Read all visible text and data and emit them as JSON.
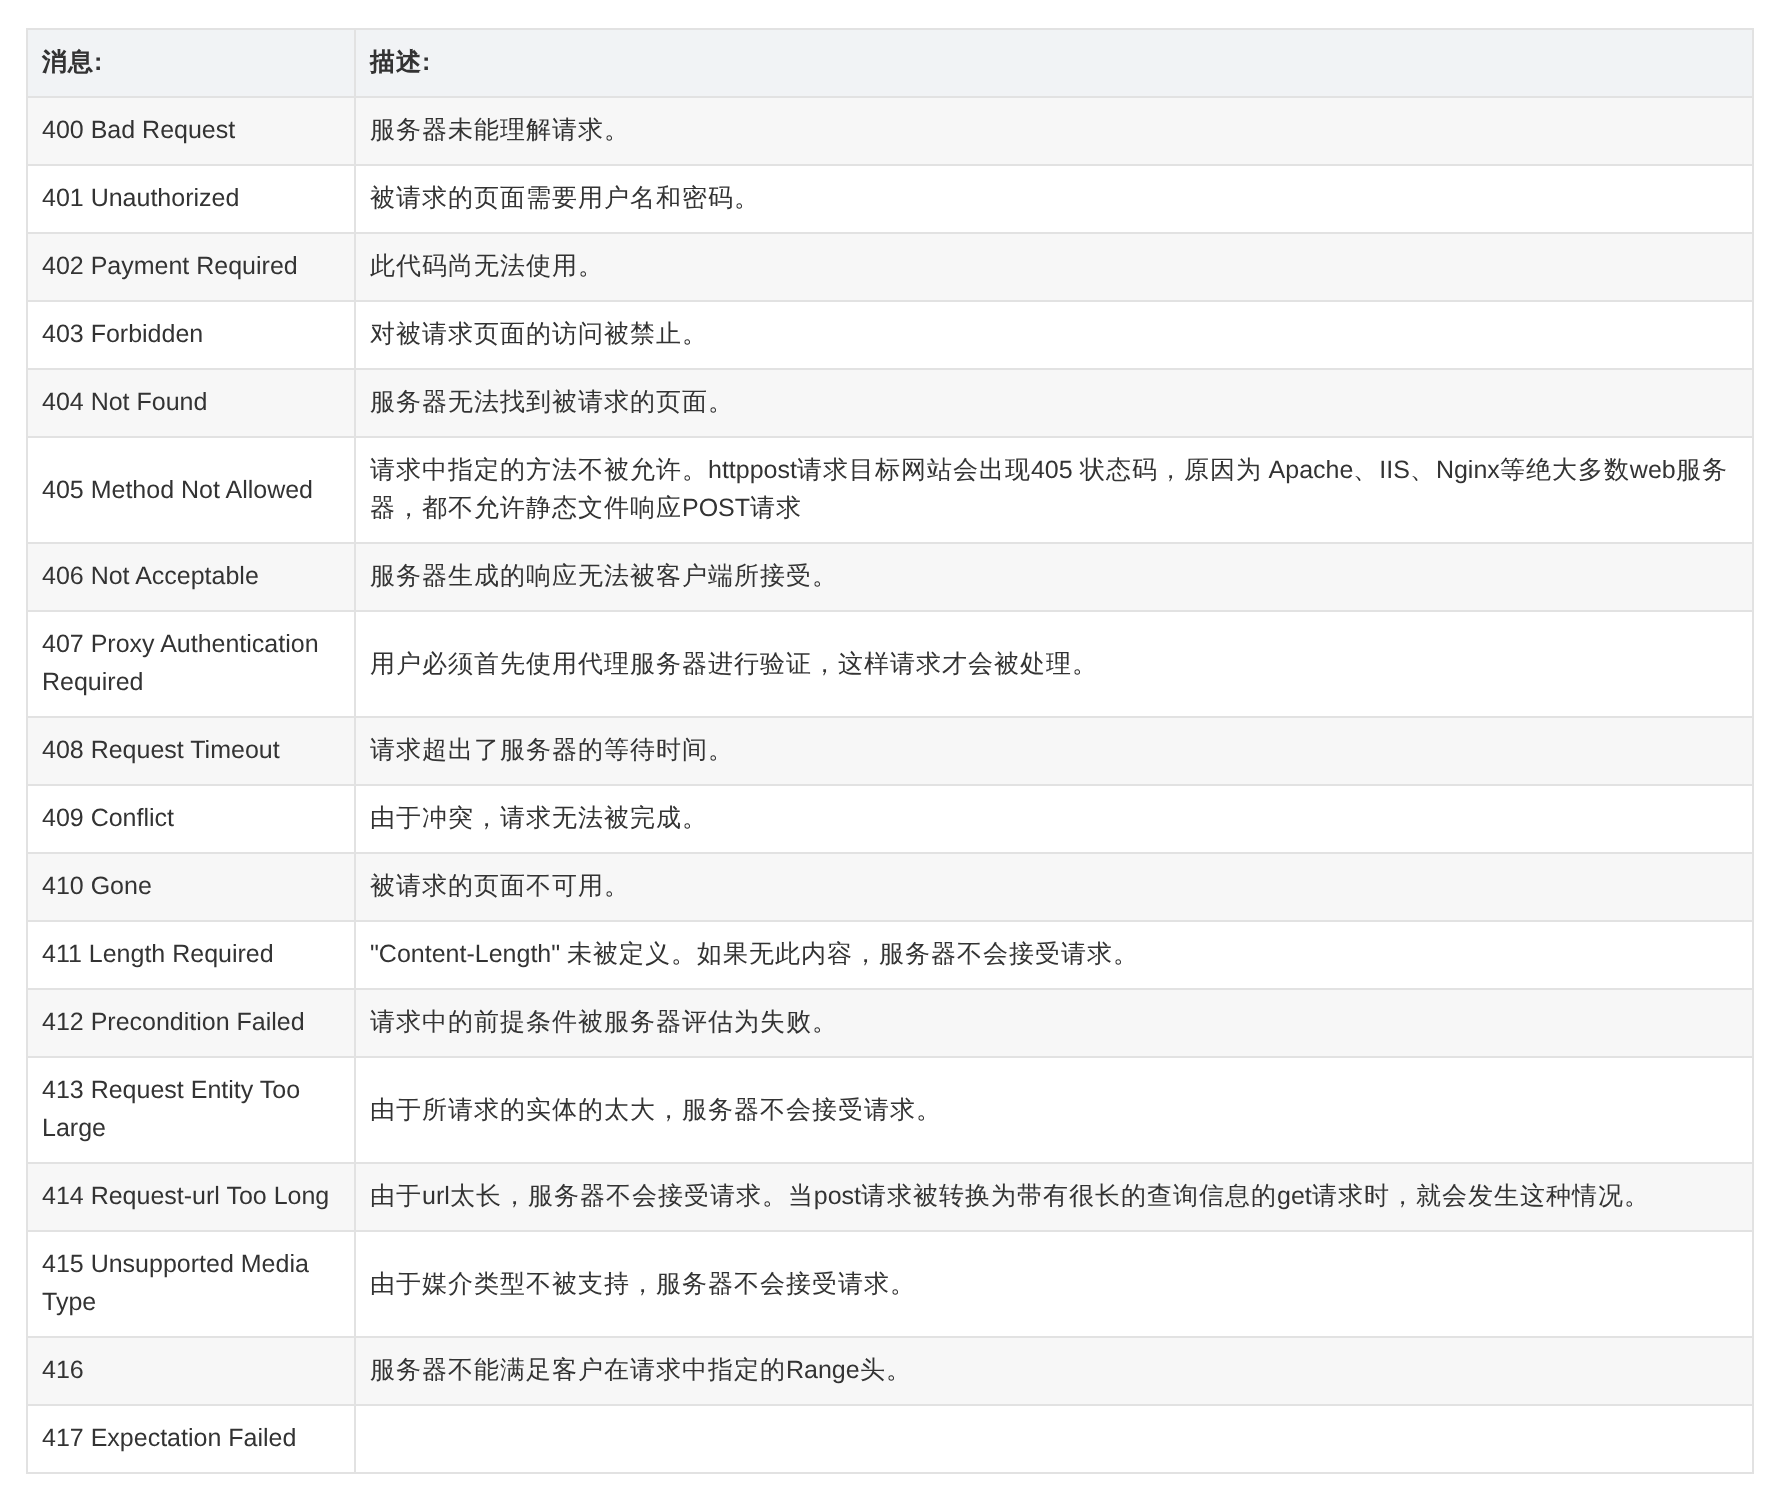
{
  "table": {
    "columns": [
      "消息:",
      "描述:"
    ],
    "rows": [
      {
        "message": "400 Bad Request",
        "description": "服务器未能理解请求。"
      },
      {
        "message": "401 Unauthorized",
        "description": "被请求的页面需要用户名和密码。"
      },
      {
        "message": "402 Payment Required",
        "description": "此代码尚无法使用。"
      },
      {
        "message": "403 Forbidden",
        "description": "对被请求页面的访问被禁止。"
      },
      {
        "message": "404 Not Found",
        "description": "服务器无法找到被请求的页面。"
      },
      {
        "message": "405 Method Not Allowed",
        "description": "请求中指定的方法不被允许。httppost请求目标网站会出现405 状态码，原因为 Apache、IIS、Nginx等绝大多数web服务器，都不允许静态文件响应POST请求"
      },
      {
        "message": "406 Not Acceptable",
        "description": "服务器生成的响应无法被客户端所接受。"
      },
      {
        "message": "407 Proxy Authentication Required",
        "description": "用户必须首先使用代理服务器进行验证，这样请求才会被处理。"
      },
      {
        "message": "408 Request Timeout",
        "description": "请求超出了服务器的等待时间。"
      },
      {
        "message": "409 Conflict",
        "description": "由于冲突，请求无法被完成。"
      },
      {
        "message": "410 Gone",
        "description": "被请求的页面不可用。"
      },
      {
        "message": "411 Length Required",
        "description": "\"Content-Length\" 未被定义。如果无此内容，服务器不会接受请求。"
      },
      {
        "message": "412 Precondition Failed",
        "description": "请求中的前提条件被服务器评估为失败。"
      },
      {
        "message": "413 Request Entity Too Large",
        "description": "由于所请求的实体的太大，服务器不会接受请求。"
      },
      {
        "message": "414 Request-url Too Long",
        "description": "由于url太长，服务器不会接受请求。当post请求被转换为带有很长的查询信息的get请求时，就会发生这种情况。"
      },
      {
        "message": "415 Unsupported Media Type",
        "description": "由于媒介类型不被支持，服务器不会接受请求。"
      },
      {
        "message": "416",
        "description": "服务器不能满足客户在请求中指定的Range头。"
      },
      {
        "message": "417 Expectation Failed"
      }
    ]
  }
}
